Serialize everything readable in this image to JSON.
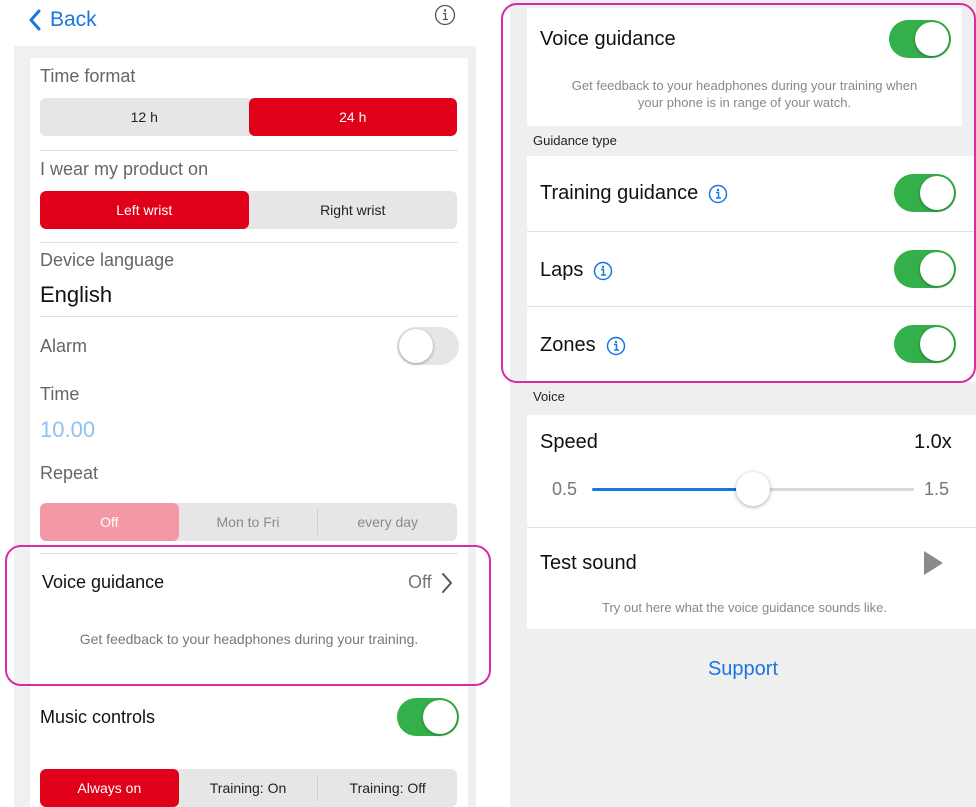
{
  "left": {
    "back_label": "Back",
    "time_format": {
      "label": "Time format",
      "options": [
        "12 h",
        "24 h"
      ],
      "selected": "24 h"
    },
    "wear": {
      "label": "I wear my product on",
      "options": [
        "Left wrist",
        "Right wrist"
      ],
      "selected": "Left wrist"
    },
    "language": {
      "label": "Device language",
      "value": "English"
    },
    "alarm": {
      "label": "Alarm",
      "enabled": false
    },
    "time": {
      "label": "Time",
      "value": "10.00"
    },
    "repeat": {
      "label": "Repeat",
      "options": [
        "Off",
        "Mon to Fri",
        "every day"
      ],
      "selected": "Off"
    },
    "voice_guidance": {
      "label": "Voice guidance",
      "value": "Off",
      "description": "Get feedback to your headphones during your training."
    },
    "music": {
      "label": "Music controls",
      "enabled": true,
      "options": [
        "Always on",
        "Training: On",
        "Training: Off"
      ],
      "selected": "Always on"
    }
  },
  "right": {
    "voice_guidance": {
      "label": "Voice guidance",
      "enabled": true,
      "description_line1": "Get feedback to your headphones during your training when",
      "description_line2": "your phone is in range of your watch."
    },
    "guidance_type_header": "Guidance type",
    "training_guidance": {
      "label": "Training guidance",
      "enabled": true
    },
    "laps": {
      "label": "Laps",
      "enabled": true
    },
    "zones": {
      "label": "Zones",
      "enabled": true
    },
    "voice_header": "Voice",
    "speed": {
      "label": "Speed",
      "value": "1.0x",
      "min_label": "0.5",
      "max_label": "1.5",
      "min": 0.5,
      "max": 1.5,
      "current": 1.0
    },
    "test_sound": {
      "label": "Test sound",
      "description": "Try out here what the voice guidance sounds like."
    },
    "support_label": "Support"
  },
  "colors": {
    "accent_red": "#e0001a",
    "toggle_green": "#34b04a",
    "link_blue": "#1877e0",
    "highlight_magenta": "#d82ca0"
  },
  "icons": [
    "chevron-left-icon",
    "info-icon",
    "chevron-right-icon",
    "play-icon"
  ]
}
